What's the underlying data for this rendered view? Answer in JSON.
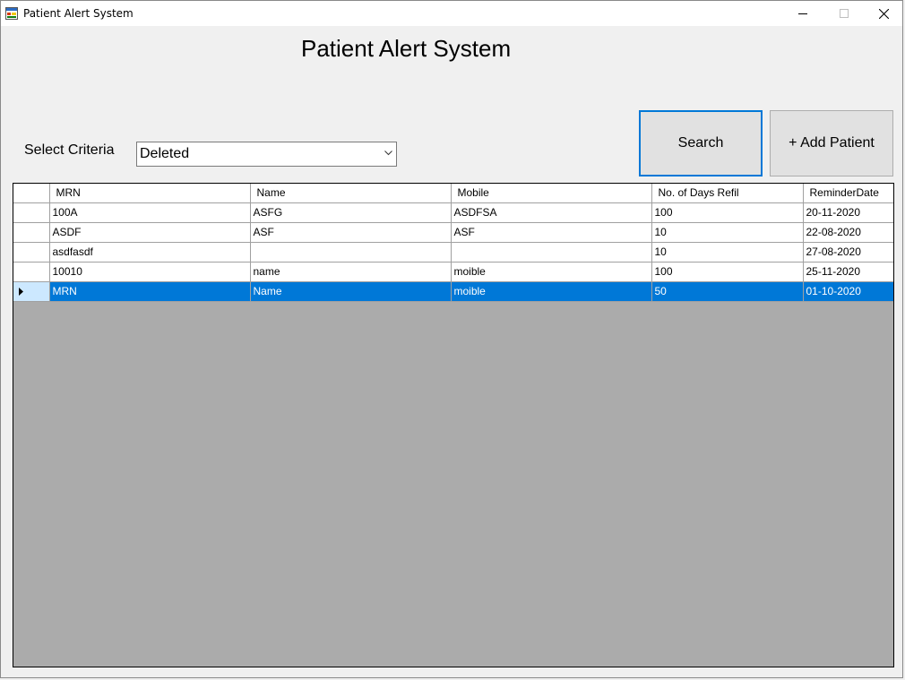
{
  "window": {
    "title": "Patient Alert System",
    "icon": "app-form-icon",
    "controls": [
      "minimize-icon",
      "maximize-icon",
      "close-icon"
    ]
  },
  "header": {
    "title": "Patient Alert System"
  },
  "criteria": {
    "label": "Select Criteria",
    "selected": "Deleted"
  },
  "buttons": {
    "search": "Search",
    "add_patient": "+ Add Patient"
  },
  "grid": {
    "columns": [
      "MRN",
      "Name",
      "Mobile",
      "No. of Days Refil",
      "ReminderDate"
    ],
    "rows": [
      [
        "100A",
        "ASFG",
        "ASDFSA",
        "100",
        "20-11-2020"
      ],
      [
        "ASDF",
        "ASF",
        "ASF",
        "10",
        "22-08-2020"
      ],
      [
        "asdfasdf",
        "",
        "",
        "10",
        "27-08-2020"
      ],
      [
        "10010",
        "name",
        "moible",
        "100",
        "25-11-2020"
      ],
      [
        "MRN",
        "Name",
        "moible",
        "50",
        "01-10-2020"
      ]
    ],
    "selected_row": 4
  },
  "colors": {
    "selection": "#0078d7",
    "row_header_selected": "#cce8ff",
    "grid_background": "#ababab",
    "window_background": "#f0f0f0"
  }
}
